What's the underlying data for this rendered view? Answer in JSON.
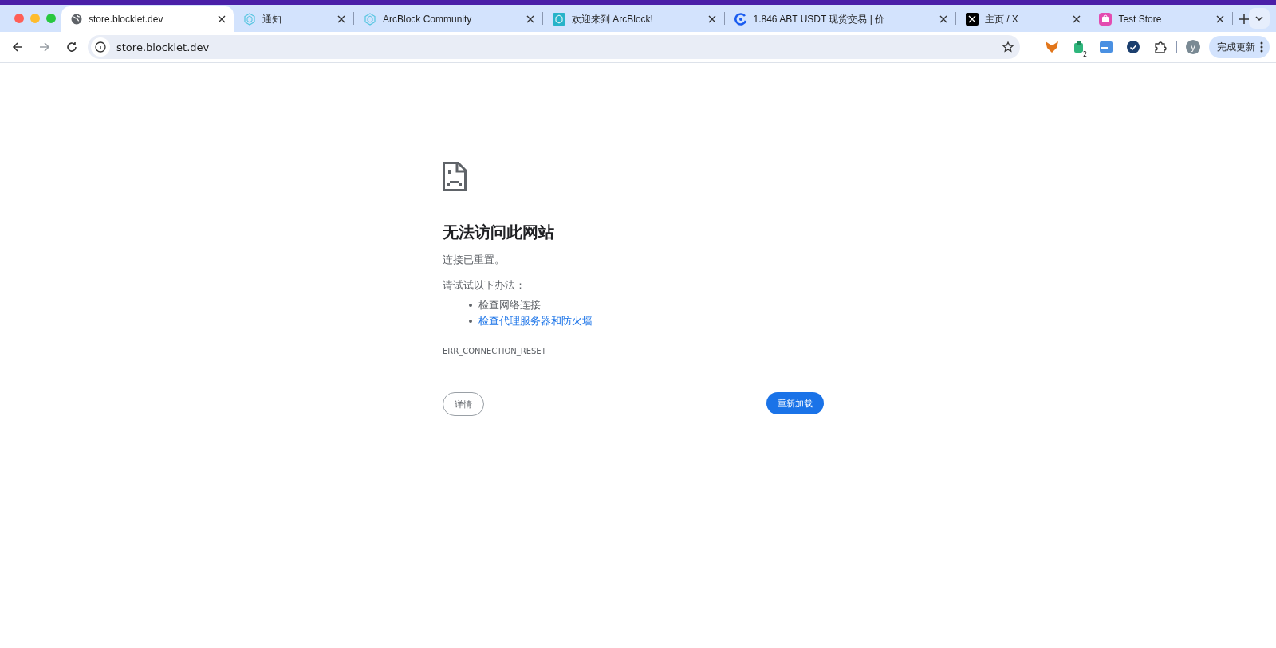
{
  "tabs": [
    {
      "title": "store.blocklet.dev",
      "kind": "globe",
      "selected": true
    },
    {
      "title": "通知",
      "kind": "hex",
      "selected": false
    },
    {
      "title": "ArcBlock Community",
      "kind": "hex",
      "selected": false
    },
    {
      "title": "欢迎来到 ArcBlock!",
      "kind": "square",
      "selected": false
    },
    {
      "title": "1.846 ABT USDT 现货交易 | 价",
      "kind": "ring",
      "selected": false
    },
    {
      "title": "主页 / X",
      "kind": "x",
      "selected": false
    },
    {
      "title": "Test Store",
      "kind": "bag",
      "selected": false
    }
  ],
  "address_bar": {
    "url": "store.blocklet.dev"
  },
  "extensions": [
    {
      "kind": "fox"
    },
    {
      "kind": "wallet",
      "badge": "2"
    },
    {
      "kind": "card"
    },
    {
      "kind": "check"
    },
    {
      "kind": "puzzle"
    }
  ],
  "profile": {
    "initial": "y"
  },
  "update_button": {
    "label": "完成更新"
  },
  "error_page": {
    "title": "无法访问此网站",
    "message": "连接已重置。",
    "suggestions_heading": "请试试以下办法：",
    "suggestions": [
      {
        "text": "检查网络连接",
        "kind": "text"
      },
      {
        "text": "检查代理服务器和防火墙",
        "kind": "link"
      }
    ],
    "error_code": "ERR_CONNECTION_RESET",
    "details_button": "详情",
    "reload_button": "重新加载"
  }
}
